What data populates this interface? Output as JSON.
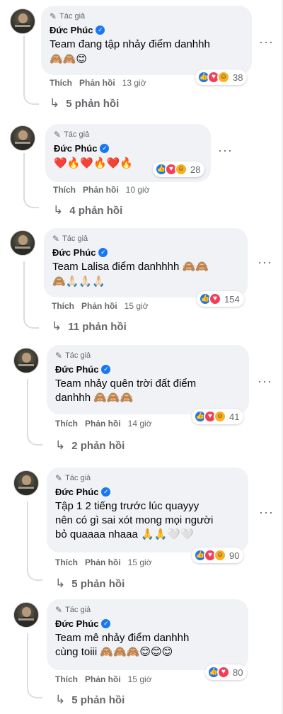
{
  "author_tag_label": "Tác giả",
  "author_name": "Đức Phúc",
  "like_label": "Thích",
  "reply_label": "Phản hồi",
  "more_label": "···",
  "colors": {
    "accent": "#1877f2",
    "love": "#f33e58",
    "haha": "#f7b125",
    "bubble": "#f0f2f5",
    "muted": "#65676b"
  },
  "comments": [
    {
      "text_lines": [
        "Team đang tập nhảy điểm danhhh",
        "🙈🙈😊"
      ],
      "reactions": [
        "like",
        "love",
        "haha"
      ],
      "reaction_count": "38",
      "time": "13 giờ",
      "replies": "5 phản hồi"
    },
    {
      "text_lines": [
        "❤️🔥❤️🔥❤️🔥"
      ],
      "reactions": [
        "like",
        "love",
        "haha"
      ],
      "reaction_count": "28",
      "time": "10 giờ",
      "replies": "4 phản hồi"
    },
    {
      "text_lines": [
        "Team Lalisa điểm danhhhh 🙈🙈",
        "🙈🙏🏻🙏🏻🙏🏻"
      ],
      "reactions": [
        "like",
        "love"
      ],
      "reaction_count": "154",
      "time": "15 giờ",
      "replies": "11 phản hồi"
    },
    {
      "text_lines": [
        "Team nhảy quên trời đất điểm",
        "danhhh 🙈🙈🙈"
      ],
      "reactions": [
        "like",
        "love",
        "haha"
      ],
      "reaction_count": "41",
      "time": "14 giờ",
      "replies": "2 phản hồi"
    },
    {
      "text_lines": [
        "Tập 1 2 tiếng trước lúc quayyy",
        "nên có gì sai xót mong mọi người",
        "bỏ quaaaa nhaaa 🙏🙏🤍🤍"
      ],
      "reactions": [
        "like",
        "love",
        "haha"
      ],
      "reaction_count": "90",
      "time": "15 giờ",
      "replies": "5 phản hồi"
    },
    {
      "text_lines": [
        "Team mê nhảy điểm danhhh",
        "cùng toiii 🙈🙈🙈😊😊😊"
      ],
      "reactions": [
        "like",
        "love"
      ],
      "reaction_count": "80",
      "time": "15 giờ",
      "replies": "5 phản hồi"
    }
  ]
}
